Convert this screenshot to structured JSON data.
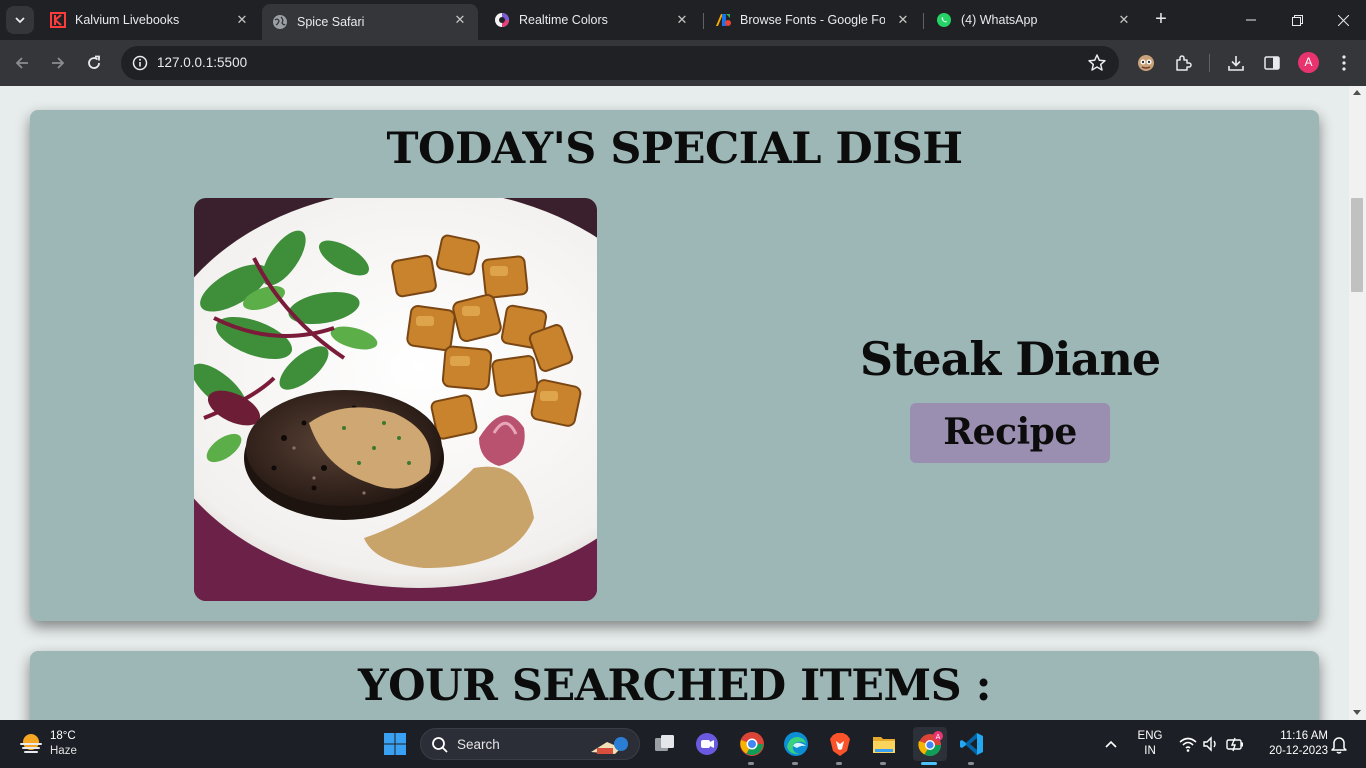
{
  "browser": {
    "tabs": [
      {
        "title": "Kalvium Livebooks",
        "active": false,
        "icon": "kalvium-icon"
      },
      {
        "title": "Spice Safari",
        "active": true,
        "icon": "globe-icon"
      },
      {
        "title": "Realtime Colors",
        "active": false,
        "icon": "realtime-colors-icon"
      },
      {
        "title": "Browse Fonts - Google Fonts",
        "active": false,
        "icon": "google-fonts-icon"
      },
      {
        "title": "(4) WhatsApp",
        "active": false,
        "icon": "whatsapp-icon"
      }
    ],
    "url": "127.0.0.1:5500",
    "profile_initial": "A",
    "accent": "#e8336e"
  },
  "page": {
    "special": {
      "heading": "TODAY'S SPECIAL DISH",
      "dish_name": "Steak Diane",
      "recipe_label": "Recipe"
    },
    "searched": {
      "heading": "YOUR SEARCHED ITEMS :"
    },
    "colors": {
      "card_bg": "#9db7b7",
      "page_bg": "#e7edec",
      "button_bg": "#9a8fb0"
    }
  },
  "taskbar": {
    "weather_temp": "18°C",
    "weather_desc": "Haze",
    "search_label": "Search",
    "lang_line1": "ENG",
    "lang_line2": "IN",
    "time": "11:16 AM",
    "date": "20-12-2023"
  }
}
